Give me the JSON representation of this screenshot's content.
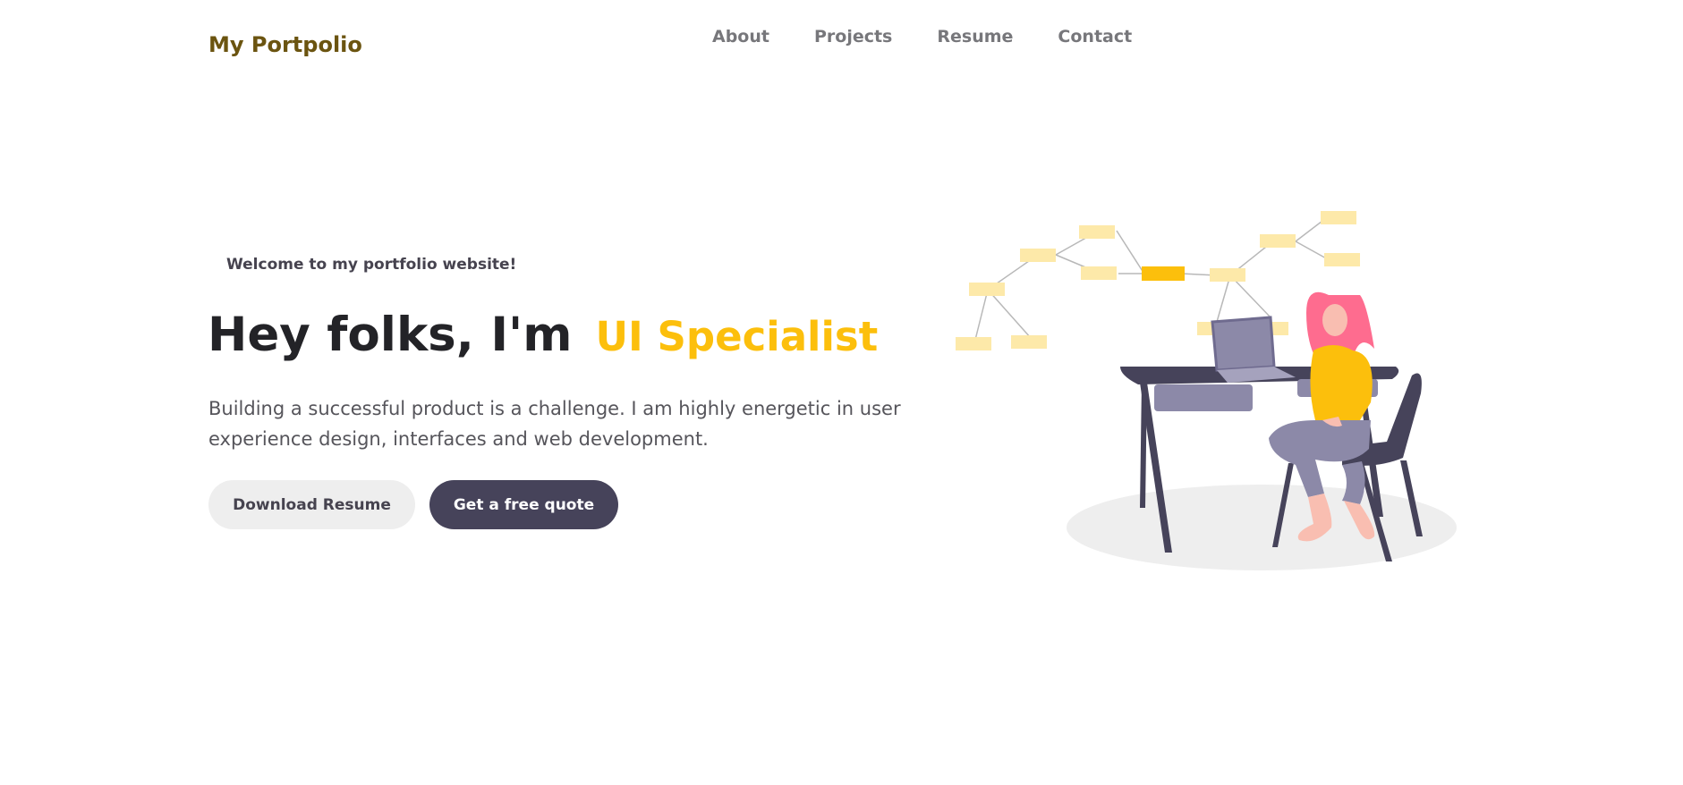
{
  "header": {
    "brand": "My Portpolio",
    "nav": [
      "About",
      "Projects",
      "Resume",
      "Contact"
    ]
  },
  "hero": {
    "welcome": "Welcome to my portfolio website!",
    "headline": "Hey folks, I'm",
    "role": "UI Specialist",
    "description": "Building a successful product is a challenge. I am highly energetic in user experience design, interfaces and web development.",
    "buttons": {
      "download": "Download Resume",
      "quote": "Get a free quote"
    }
  },
  "colors": {
    "brand": "#6b5410",
    "accent": "#fcbf0c",
    "dark": "#46435a",
    "text": "#232327"
  }
}
